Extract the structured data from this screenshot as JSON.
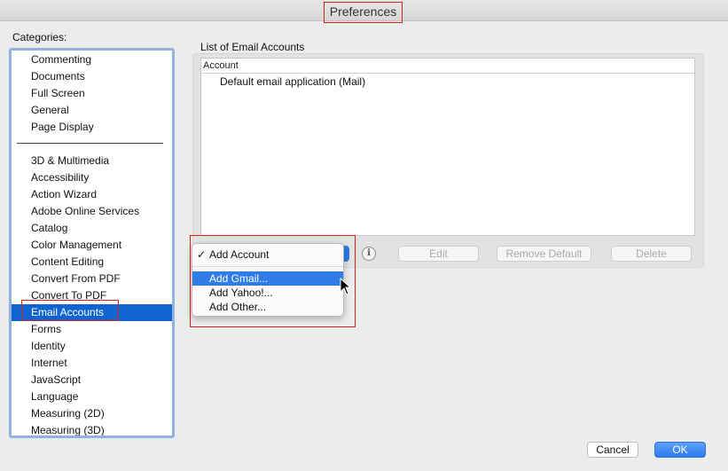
{
  "window": {
    "title": "Preferences"
  },
  "categories": {
    "label": "Categories:",
    "group1": [
      "Commenting",
      "Documents",
      "Full Screen",
      "General",
      "Page Display"
    ],
    "group2": [
      "3D & Multimedia",
      "Accessibility",
      "Action Wizard",
      "Adobe Online Services",
      "Catalog",
      "Color Management",
      "Content Editing",
      "Convert From PDF",
      "Convert To PDF",
      "Email Accounts",
      "Forms",
      "Identity",
      "Internet",
      "JavaScript",
      "Language",
      "Measuring (2D)",
      "Measuring (3D)"
    ],
    "selected": "Email Accounts"
  },
  "email_accounts": {
    "section_label": "List of Email Accounts",
    "table_header": "Account",
    "rows": [
      "Default email application (Mail)"
    ],
    "info_icon": "info-icon",
    "buttons": {
      "edit": "Edit",
      "remove_default": "Remove Default",
      "delete": "Delete"
    }
  },
  "dropdown": {
    "checked_item": "Add Account",
    "check_mark": "✓",
    "items": [
      "Add Gmail...",
      "Add Yahoo!...",
      "Add Other..."
    ],
    "active_item": "Add Gmail..."
  },
  "footer": {
    "cancel": "Cancel",
    "ok": "OK"
  },
  "colors": {
    "selection": "#0f64d2",
    "accent": "#2f7ce9",
    "annotation": "#d8201a"
  }
}
